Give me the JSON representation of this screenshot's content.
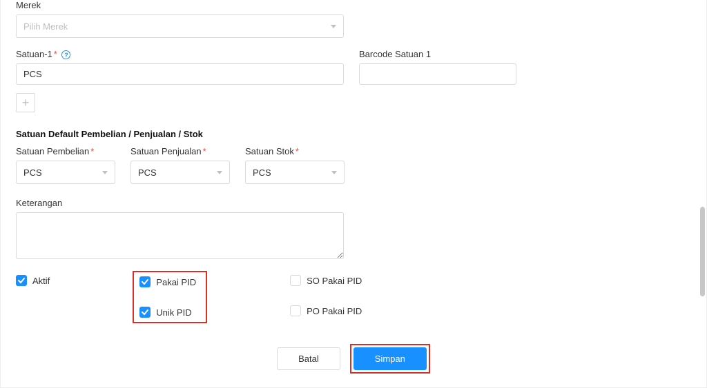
{
  "merek": {
    "label": "Merek",
    "placeholder": "Pilih Merek"
  },
  "satuan1": {
    "label": "Satuan-1",
    "value": "PCS"
  },
  "barcode1": {
    "label": "Barcode Satuan 1",
    "value": ""
  },
  "section_defaults": "Satuan Default Pembelian / Penjualan / Stok",
  "satuan_pembelian": {
    "label": "Satuan Pembelian",
    "value": "PCS"
  },
  "satuan_penjualan": {
    "label": "Satuan Penjualan",
    "value": "PCS"
  },
  "satuan_stok": {
    "label": "Satuan Stok",
    "value": "PCS"
  },
  "keterangan": {
    "label": "Keterangan",
    "value": ""
  },
  "checks": {
    "aktif": "Aktif",
    "pakai_pid": "Pakai PID",
    "unik_pid": "Unik PID",
    "so_pakai_pid": "SO Pakai PID",
    "po_pakai_pid": "PO Pakai PID"
  },
  "buttons": {
    "cancel": "Batal",
    "save": "Simpan"
  }
}
